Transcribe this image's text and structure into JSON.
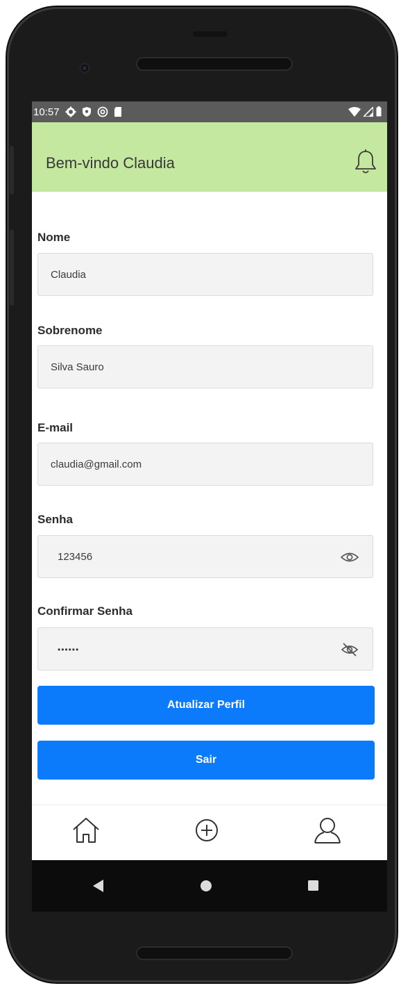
{
  "status_bar": {
    "time": "10:57",
    "left_icons": [
      "settings-icon",
      "shield-icon",
      "at-icon",
      "sd-card-icon"
    ],
    "right_icons": [
      "wifi-icon",
      "signal-icon",
      "battery-icon"
    ]
  },
  "header": {
    "title": "Bem-vindo Claudia",
    "background_color": "#c5e8a0",
    "notification_icon": "bell-icon"
  },
  "form": {
    "nome": {
      "label": "Nome",
      "value": "Claudia"
    },
    "sobrenome": {
      "label": "Sobrenome",
      "value": "Silva Sauro"
    },
    "email": {
      "label": "E-mail",
      "value": "claudia@gmail.com"
    },
    "senha": {
      "label": "Senha",
      "value": "123456",
      "toggle_icon": "eye-icon"
    },
    "confirmar_senha": {
      "label": "Confirmar Senha",
      "value": "••••••",
      "toggle_icon": "eye-off-icon"
    }
  },
  "buttons": {
    "update": "Atualizar Perfil",
    "logout": "Sair",
    "color": "#0b7bfc"
  },
  "bottom_nav": {
    "items": [
      "home-icon",
      "add-circle-icon",
      "user-icon"
    ]
  },
  "system_nav": {
    "items": [
      "back-icon",
      "home-dot-icon",
      "recents-icon"
    ]
  }
}
